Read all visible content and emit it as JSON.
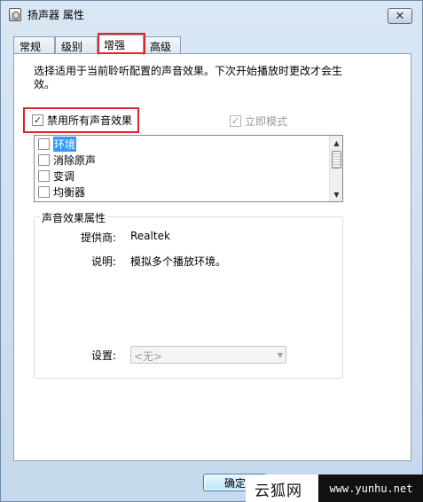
{
  "window": {
    "title": "扬声器 属性",
    "close_glyph": "✕"
  },
  "tabs": [
    {
      "label": "常规"
    },
    {
      "label": "级别"
    },
    {
      "label": "增强",
      "active": true
    },
    {
      "label": "高级"
    }
  ],
  "enhancements": {
    "description": "选择适用于当前聆听配置的声音效果。下次开始播放时更改才会生效。",
    "disable_all": {
      "label": "禁用所有声音效果",
      "checked": true
    },
    "immediate_mode": {
      "label": "立即模式",
      "checked": true,
      "disabled": true
    },
    "effects": [
      {
        "label": "环境",
        "checked": false,
        "selected": true
      },
      {
        "label": "消除原声",
        "checked": false,
        "selected": false
      },
      {
        "label": "变调",
        "checked": false,
        "selected": false
      },
      {
        "label": "均衡器",
        "checked": false,
        "selected": false
      }
    ]
  },
  "properties": {
    "group_title": "声音效果属性",
    "provider_label": "提供商:",
    "provider_value": "Realtek",
    "description_label": "说明:",
    "description_value": "模拟多个播放环境。",
    "settings_label": "设置:",
    "settings_value": "<无>"
  },
  "buttons": {
    "ok_label": "确定"
  },
  "watermark": {
    "brand": "云狐网",
    "url": "www.yunhu.net"
  },
  "icons": {
    "window": "speaker-properties-icon",
    "check": "✓",
    "scroll_up": "▲",
    "scroll_down": "▼",
    "combo_arrow": "▼"
  },
  "highlight_color": "#d9262c"
}
